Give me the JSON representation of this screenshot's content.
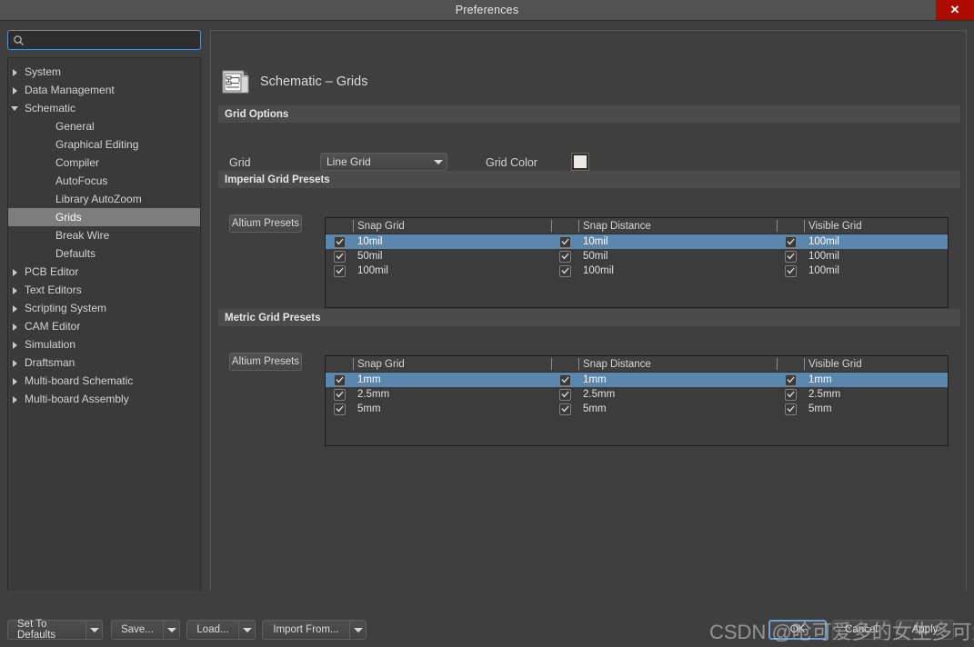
{
  "window": {
    "title": "Preferences",
    "close_label": "✕"
  },
  "search": {
    "placeholder": "",
    "value": "",
    "icon": "search-icon"
  },
  "sidebar": {
    "items": [
      {
        "label": "System",
        "level": 0,
        "arrow": "collapsed",
        "selected": false
      },
      {
        "label": "Data Management",
        "level": 0,
        "arrow": "collapsed",
        "selected": false
      },
      {
        "label": "Schematic",
        "level": 0,
        "arrow": "expanded",
        "selected": false
      },
      {
        "label": "General",
        "level": 1,
        "arrow": "none",
        "selected": false
      },
      {
        "label": "Graphical Editing",
        "level": 1,
        "arrow": "none",
        "selected": false
      },
      {
        "label": "Compiler",
        "level": 1,
        "arrow": "none",
        "selected": false
      },
      {
        "label": "AutoFocus",
        "level": 1,
        "arrow": "none",
        "selected": false
      },
      {
        "label": "Library AutoZoom",
        "level": 1,
        "arrow": "none",
        "selected": false
      },
      {
        "label": "Grids",
        "level": 1,
        "arrow": "none",
        "selected": true
      },
      {
        "label": "Break Wire",
        "level": 1,
        "arrow": "none",
        "selected": false
      },
      {
        "label": "Defaults",
        "level": 1,
        "arrow": "none",
        "selected": false
      },
      {
        "label": "PCB Editor",
        "level": 0,
        "arrow": "collapsed",
        "selected": false
      },
      {
        "label": "Text Editors",
        "level": 0,
        "arrow": "collapsed",
        "selected": false
      },
      {
        "label": "Scripting System",
        "level": 0,
        "arrow": "collapsed",
        "selected": false
      },
      {
        "label": "CAM Editor",
        "level": 0,
        "arrow": "collapsed",
        "selected": false
      },
      {
        "label": "Simulation",
        "level": 0,
        "arrow": "collapsed",
        "selected": false
      },
      {
        "label": "Draftsman",
        "level": 0,
        "arrow": "collapsed",
        "selected": false
      },
      {
        "label": "Multi-board Schematic",
        "level": 0,
        "arrow": "collapsed",
        "selected": false
      },
      {
        "label": "Multi-board Assembly",
        "level": 0,
        "arrow": "collapsed",
        "selected": false
      }
    ]
  },
  "page": {
    "title": "Schematic – Grids",
    "icon": "schematic-page-icon"
  },
  "grid_options": {
    "section_title": "Grid Options",
    "grid_label": "Grid",
    "grid_value": "Line Grid",
    "grid_color_label": "Grid Color",
    "grid_color_value": "#ebebe3"
  },
  "imperial_presets": {
    "section_title": "Imperial Grid Presets",
    "altium_presets_label": "Altium Presets",
    "columns": [
      "Snap Grid",
      "Snap Distance",
      "Visible Grid"
    ],
    "rows": [
      {
        "selected": true,
        "snap_grid_checked": true,
        "snap_grid": "10mil",
        "snap_distance_checked": true,
        "snap_distance": "10mil",
        "visible_grid_checked": true,
        "visible_grid": "100mil"
      },
      {
        "selected": false,
        "snap_grid_checked": true,
        "snap_grid": "50mil",
        "snap_distance_checked": true,
        "snap_distance": "50mil",
        "visible_grid_checked": true,
        "visible_grid": "100mil"
      },
      {
        "selected": false,
        "snap_grid_checked": true,
        "snap_grid": "100mil",
        "snap_distance_checked": true,
        "snap_distance": "100mil",
        "visible_grid_checked": true,
        "visible_grid": "100mil"
      }
    ]
  },
  "metric_presets": {
    "section_title": "Metric Grid Presets",
    "altium_presets_label": "Altium Presets",
    "columns": [
      "Snap Grid",
      "Snap Distance",
      "Visible Grid"
    ],
    "rows": [
      {
        "selected": true,
        "snap_grid_checked": true,
        "snap_grid": "1mm",
        "snap_distance_checked": true,
        "snap_distance": "1mm",
        "visible_grid_checked": true,
        "visible_grid": "1mm"
      },
      {
        "selected": false,
        "snap_grid_checked": true,
        "snap_grid": "2.5mm",
        "snap_distance_checked": true,
        "snap_distance": "2.5mm",
        "visible_grid_checked": true,
        "visible_grid": "2.5mm"
      },
      {
        "selected": false,
        "snap_grid_checked": true,
        "snap_grid": "5mm",
        "snap_distance_checked": true,
        "snap_distance": "5mm",
        "visible_grid_checked": true,
        "visible_grid": "5mm"
      }
    ]
  },
  "footer": {
    "set_to_defaults": "Set To Defaults",
    "save": "Save...",
    "load": "Load...",
    "import_from": "Import From...",
    "ok": "OK",
    "cancel": "Cancel",
    "apply": "Apply"
  },
  "watermark": {
    "text": "CSDN @呛可爱多的女生多可爱"
  }
}
